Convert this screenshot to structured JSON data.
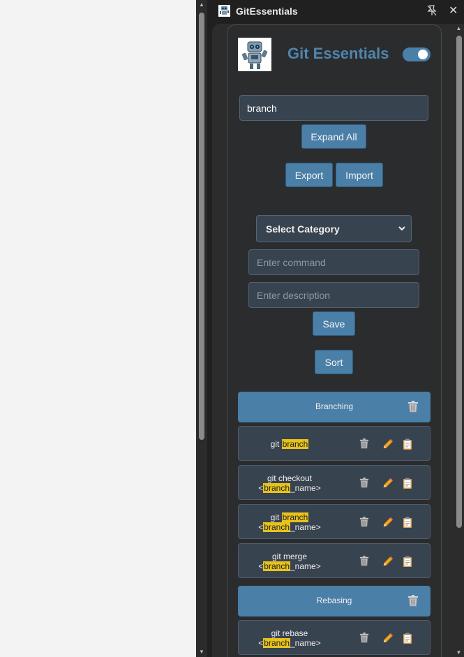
{
  "window": {
    "title": "GitEssentials"
  },
  "header": {
    "title": "Git Essentials",
    "toggle_on": true
  },
  "search": {
    "value": "branch"
  },
  "buttons": {
    "expand_all": "Expand All",
    "export": "Export",
    "import": "Import",
    "save": "Save",
    "sort": "Sort"
  },
  "form": {
    "category_selected": "Select Category",
    "command_placeholder": "Enter command",
    "description_placeholder": "Enter description"
  },
  "categories": [
    {
      "name": "Branching",
      "commands": [
        {
          "parts": [
            "git ",
            "branch"
          ]
        },
        {
          "line1": "git checkout",
          "line2_parts": [
            "<",
            "branch",
            "_name>"
          ]
        },
        {
          "line1_parts": [
            "git ",
            "branch"
          ],
          "line2_parts": [
            "<",
            "branch",
            "_name>"
          ]
        },
        {
          "line1": "git merge",
          "line2_parts": [
            "<",
            "branch",
            "_name>"
          ]
        }
      ]
    },
    {
      "name": "Rebasing",
      "commands": [
        {
          "line1": "git rebase",
          "line2_parts": [
            "<",
            "branch",
            "_name>"
          ]
        }
      ]
    }
  ],
  "icons": {
    "trash": "trash-icon",
    "edit": "pencil-icon",
    "copy": "clipboard-icon"
  },
  "colors": {
    "accent": "#4a7fa8",
    "highlight": "#e8c31b",
    "title": "#4f86ae"
  }
}
